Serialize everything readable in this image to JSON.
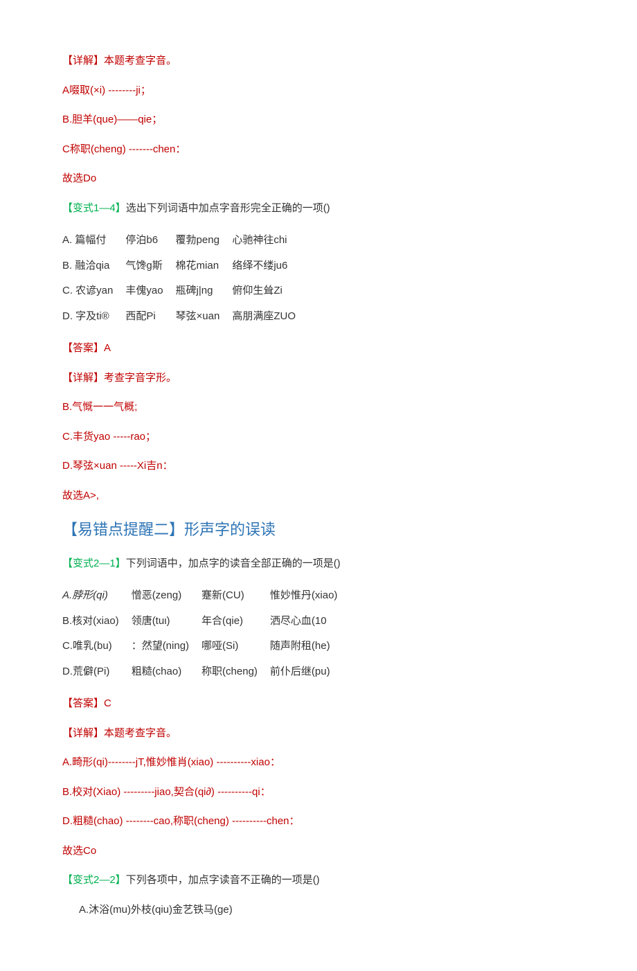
{
  "section1": {
    "detail_label": "【详解】",
    "detail_text": "本题考查字音。",
    "lineA": "A啜取(×i) --------ji；",
    "lineB": "B.胆羊(que)——qie；",
    "lineC": "C称职(cheng) -------chen：",
    "choose": "故选Do",
    "variant_label": "【变式1—4】",
    "variant_text": "选出下列词语中加点字音形完全正确的一项()",
    "table": [
      [
        "A.  篇幅付",
        "停泊b6",
        "覆勃peng",
        "心驰神往chi"
      ],
      [
        "B.  融洽qia",
        "气馋ɡ斯",
        "棉花mian",
        "络绎不缕ju6"
      ],
      [
        "C.  农谚yan",
        "丰傀yao",
        "瓶碑j|ng",
        "俯仰生耸Zi"
      ],
      [
        "D.  字及ti®",
        "西配Pi",
        "琴弦×uan",
        "高朋满座ZUO"
      ]
    ],
    "answer_label": "【答案】",
    "answer_val": "A",
    "detail2_label": "【详解】",
    "detail2_text": "考查字音字形。",
    "expB": "B.气慨一一气概;",
    "expC": "C.丰货yao -----rao；",
    "expD": "D.琴弦×uan -----Xi吉n：",
    "choose2": "故选A>,"
  },
  "section2": {
    "heading": "【易错点提醒二】形声字的误读",
    "variant1_label": "【变式2—1】",
    "variant1_text": "下列词语中，加点字的读音全部正确的一项是()",
    "table": [
      [
        "A.脖形(qi)",
        "憎恶(zeng)",
        "蹇新(CU)",
        "惟妙惟丹(xiao)"
      ],
      [
        "B.核对(xiao)",
        "领唐(tuι)",
        "年合(qie)",
        "洒尽心血(10"
      ],
      [
        "C.唯乳(bu)",
        "：然望(ning)",
        "哪哑(Si)",
        "随声附租(he)"
      ],
      [
        "D.荒僻(Pi)",
        "粗糙(chao)",
        "称职(cheng)",
        "前仆后继(pu)"
      ]
    ],
    "answer_label": "【答案】",
    "answer_val": "C",
    "detail_label": "【详解】",
    "detail_text": "本题考查字音。",
    "lineA": "A.畸形(qi)--------jT,惟妙惟肖(xiao) ----------xiao：",
    "lineB": "B.校对(Xiao) ---------jiao,契合(qi∂) ----------qi：",
    "lineD": "D.粗糙(chao) --------cao,称职(cheng) ----------chen：",
    "choose": "故选Co",
    "variant2_label": "【变式2—2】",
    "variant2_text": "下列各项中，加点字读音不正确的一项是()",
    "optA": "A.沐浴(mu)外枝(qiu)金艺铁马(ge)"
  }
}
